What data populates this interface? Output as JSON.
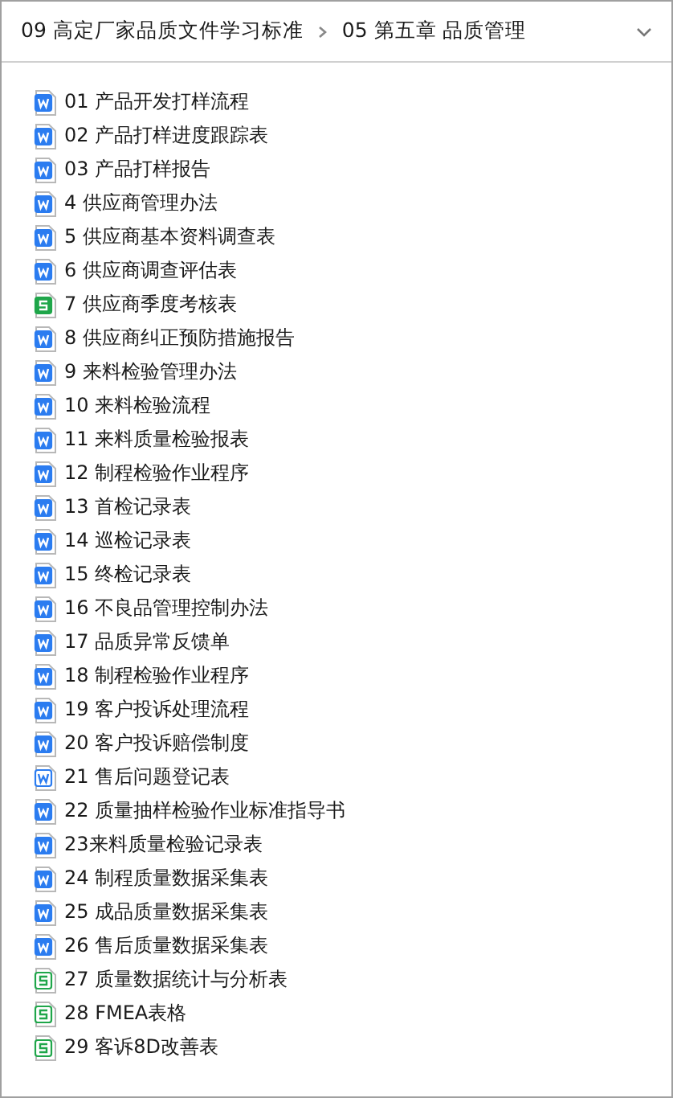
{
  "breadcrumb": [
    "09  高定厂家品质文件学习标准",
    "05 第五章 品质管理"
  ],
  "files": [
    {
      "name": "01 产品开发打样流程",
      "kind": "word"
    },
    {
      "name": "02 产品打样进度跟踪表",
      "kind": "word"
    },
    {
      "name": "03 产品打样报告",
      "kind": "word"
    },
    {
      "name": "4 供应商管理办法",
      "kind": "word"
    },
    {
      "name": "5 供应商基本资料调查表",
      "kind": "word"
    },
    {
      "name": "6 供应商调查评估表",
      "kind": "word"
    },
    {
      "name": "7 供应商季度考核表",
      "kind": "sheet"
    },
    {
      "name": "8 供应商纠正预防措施报告",
      "kind": "word"
    },
    {
      "name": "9 来料检验管理办法",
      "kind": "word"
    },
    {
      "name": "10 来料检验流程",
      "kind": "word"
    },
    {
      "name": "11 来料质量检验报表",
      "kind": "word"
    },
    {
      "name": "12 制程检验作业程序",
      "kind": "word"
    },
    {
      "name": "13 首检记录表",
      "kind": "word"
    },
    {
      "name": "14 巡检记录表",
      "kind": "word"
    },
    {
      "name": "15 终检记录表",
      "kind": "word"
    },
    {
      "name": "16 不良品管理控制办法",
      "kind": "word"
    },
    {
      "name": "17 品质异常反馈单",
      "kind": "word"
    },
    {
      "name": "18 制程检验作业程序",
      "kind": "word"
    },
    {
      "name": "19 客户投诉处理流程",
      "kind": "word"
    },
    {
      "name": "20 客户投诉赔偿制度",
      "kind": "word"
    },
    {
      "name": "21 售后问题登记表",
      "kind": "word-outline"
    },
    {
      "name": "22 质量抽样检验作业标准指导书",
      "kind": "word"
    },
    {
      "name": "23来料质量检验记录表",
      "kind": "word"
    },
    {
      "name": "24 制程质量数据采集表",
      "kind": "word"
    },
    {
      "name": "25 成品质量数据采集表",
      "kind": "word"
    },
    {
      "name": "26 售后质量数据采集表",
      "kind": "word"
    },
    {
      "name": "27 质量数据统计与分析表",
      "kind": "sheet-outline"
    },
    {
      "name": "28 FMEA表格",
      "kind": "sheet-outline"
    },
    {
      "name": "29 客诉8D改善表",
      "kind": "sheet-outline"
    }
  ]
}
